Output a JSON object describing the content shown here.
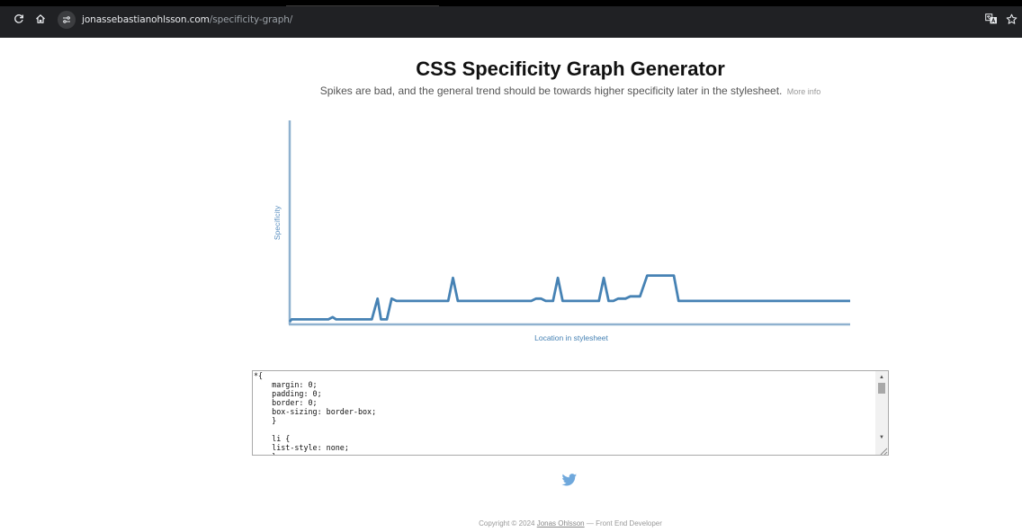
{
  "browser": {
    "url_host": "jonassebastianohlsson.com",
    "url_path": "/specificity-graph/",
    "icons": [
      "reload-icon",
      "home-icon",
      "site-settings-icon",
      "translate-icon",
      "bookmark-star-icon"
    ]
  },
  "page": {
    "title": "CSS Specificity Graph Generator",
    "subtitle": "Spikes are bad, and the general trend should be towards higher specificity later in the stylesheet.",
    "more_info": "More info"
  },
  "chart_data": {
    "type": "line",
    "xlabel": "Location in stylesheet",
    "ylabel": "Specificity",
    "grid": false,
    "legend": "none",
    "colors": {
      "line": "#4682b4",
      "axis": "#8fb1cf"
    },
    "x": [
      0,
      1,
      2,
      3,
      4,
      5,
      6,
      7,
      8,
      9,
      10,
      11,
      12,
      13,
      14,
      15,
      16,
      17,
      18,
      19,
      20,
      21,
      22,
      23,
      24,
      25,
      26,
      27,
      28,
      29,
      30,
      31,
      32,
      33,
      34,
      35,
      36,
      37,
      38,
      39,
      40,
      41,
      42,
      43,
      44,
      45,
      46
    ],
    "y": [
      0,
      1,
      1,
      1,
      1,
      1,
      1,
      1,
      1,
      1,
      1,
      1,
      1,
      1,
      1,
      1,
      1,
      1,
      1,
      1,
      1,
      1,
      1,
      1,
      1,
      1,
      1,
      1,
      1,
      1,
      1,
      1,
      1,
      1,
      1,
      1,
      1,
      1,
      1,
      1,
      1,
      1,
      1,
      1,
      1,
      1,
      1
    ],
    "points": [
      [
        0,
        0
      ],
      [
        0.4,
        1
      ],
      [
        8,
        1
      ],
      [
        8.9,
        2
      ],
      [
        9.6,
        1
      ],
      [
        17,
        1
      ],
      [
        18.2,
        10
      ],
      [
        18.9,
        1
      ],
      [
        20.1,
        1
      ],
      [
        21.1,
        10
      ],
      [
        22.1,
        9
      ],
      [
        32.8,
        9
      ],
      [
        33.8,
        19
      ],
      [
        34.8,
        9
      ],
      [
        50,
        9
      ],
      [
        51,
        10
      ],
      [
        52,
        10
      ],
      [
        53,
        9
      ],
      [
        54.5,
        9
      ],
      [
        55.5,
        19
      ],
      [
        56.5,
        9
      ],
      [
        64,
        9
      ],
      [
        65,
        19
      ],
      [
        66,
        9
      ],
      [
        67,
        9
      ],
      [
        68,
        10
      ],
      [
        69.5,
        10
      ],
      [
        70.5,
        11
      ],
      [
        72.5,
        11
      ],
      [
        74,
        20
      ],
      [
        79.5,
        20
      ],
      [
        80.5,
        9
      ],
      [
        116,
        9
      ]
    ],
    "xlim": [
      0,
      116
    ],
    "ylim": [
      0,
      88
    ]
  },
  "editor": {
    "content": "*{\n    margin: 0;\n    padding: 0;\n    border: 0;\n    box-sizing: border-box;\n    }\n\n    li {\n    list-style: none;\n    }"
  },
  "footer": {
    "prefix": "Copyright © 2024",
    "author": "Jonas Ohlsson",
    "suffix": "— Front End Developer"
  }
}
